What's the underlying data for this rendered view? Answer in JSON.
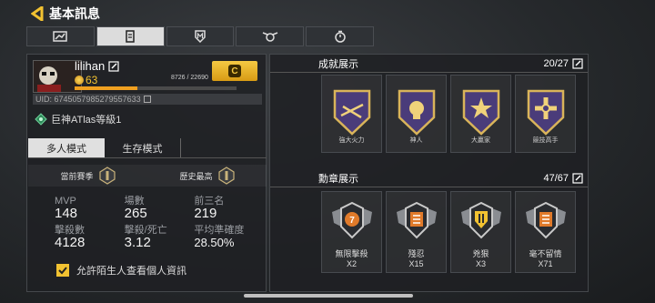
{
  "header": {
    "title": "基本訊息"
  },
  "tabs": [
    {
      "icon": "chart-icon"
    },
    {
      "icon": "notepad-icon"
    },
    {
      "icon": "shield-m-icon"
    },
    {
      "icon": "wings-badge-icon"
    },
    {
      "icon": "stopwatch-icon"
    }
  ],
  "profile": {
    "username": "lilihan",
    "level": "63",
    "xp_text": "8726 / 22690",
    "xp_fraction": 0.385,
    "uid": "UID: 6745057985279557633",
    "atlas": "巨神ATlas等級1",
    "rank_badge": "C"
  },
  "modes": {
    "multiplayer": "多人模式",
    "survival": "生存模式"
  },
  "season": {
    "current": "當前賽季",
    "best": "歷史最高"
  },
  "stats": {
    "mvp_label": "MVP",
    "mvp": "148",
    "matches_label": "場數",
    "matches": "265",
    "top3_label": "前三名",
    "top3": "219",
    "kills_label": "擊殺數",
    "kills": "4128",
    "kd_label": "擊殺/死亡",
    "kd": "3.12",
    "acc_label": "平均準確度",
    "acc": "28.50%"
  },
  "allow_label": "允許陌生人查看個人資訊",
  "achievements": {
    "title": "成就展示",
    "count": "20/27",
    "items": [
      {
        "name": "強大火力"
      },
      {
        "name": "神人"
      },
      {
        "name": "大贏家"
      },
      {
        "name": "競技高手"
      }
    ]
  },
  "medals": {
    "title": "勳章展示",
    "count": "47/67",
    "items": [
      {
        "name": "無限擊殺",
        "count": "X2",
        "color": "#e07a2a"
      },
      {
        "name": "殘忍",
        "count": "X15",
        "color": "#e07a2a"
      },
      {
        "name": "兇狠",
        "count": "X3",
        "color": "#f2c231"
      },
      {
        "name": "毫不留情",
        "count": "X71",
        "color": "#e07a2a"
      }
    ]
  },
  "colors": {
    "accent": "#f2c231",
    "panel": "#1e2023",
    "purple": "#4a3c7a"
  }
}
